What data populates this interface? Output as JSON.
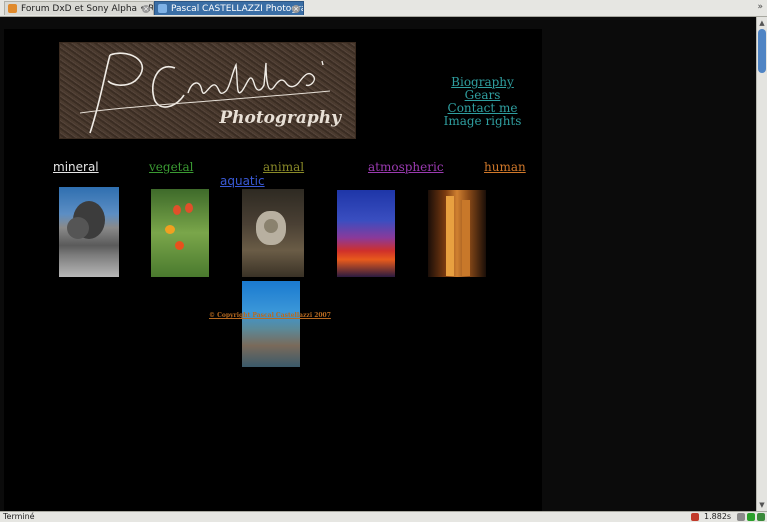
{
  "tabs": [
    {
      "label": "Forum DxD et Sony Alpha • Ré...",
      "active": false
    },
    {
      "label": "Pascal CASTELLAZZI Photogra...",
      "active": true
    }
  ],
  "tab_scroll_icon": "double-chevron-right-icon",
  "logo": {
    "signature": "PCastellazzi",
    "word": "Photography"
  },
  "top_links": {
    "biography": "Biography",
    "gears": "Gears",
    "contact": "Contact me",
    "rights": "Image rights"
  },
  "nav": {
    "mineral": "mineral",
    "vegetal": "vegetal",
    "animal": "animal",
    "atmospheric": "atmospheric",
    "human": "human",
    "aquatic": "aquatic"
  },
  "colors": {
    "mineral": "#e6e6e6",
    "vegetal": "#3a9a32",
    "animal": "#8a8a28",
    "atmospheric": "#9a3ab0",
    "human": "#d0782a",
    "aquatic": "#3a5ad8",
    "links": "#2f9fa0",
    "copyright": "#b86a20"
  },
  "copyright": "© Copyright Pascal Castellazzi 2007",
  "status": {
    "text": "Terminé",
    "time": "1.882s"
  }
}
